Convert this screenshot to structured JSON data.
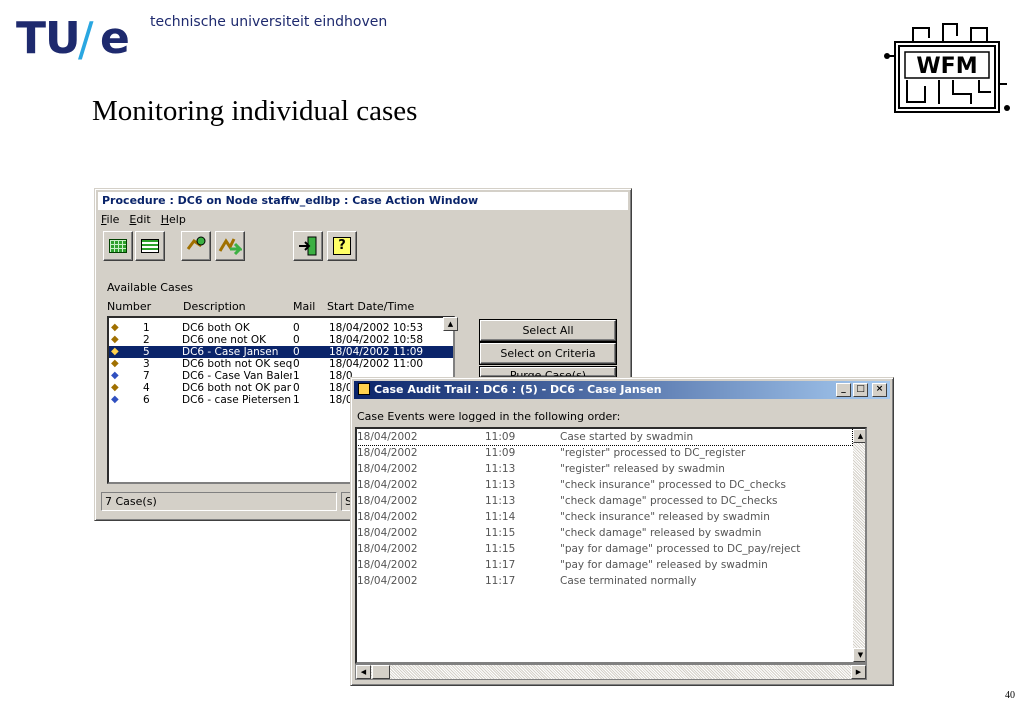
{
  "slide": {
    "logo_tu": "TU",
    "logo_slash": "/",
    "logo_e": "e",
    "university": "technische universiteit eindhoven",
    "title": "Monitoring individual cases",
    "wfm_logo_text": "WFM",
    "page_number": "40"
  },
  "main_window": {
    "title": "Procedure : DC6 on Node staffw_edlbp : Case Action Window",
    "menu": [
      {
        "label": "File",
        "accel": "F",
        "rest": "ile"
      },
      {
        "label": "Edit",
        "accel": "E",
        "rest": "dit"
      },
      {
        "label": "Help",
        "accel": "H",
        "rest": "elp"
      }
    ],
    "available_label": "Available Cases",
    "columns": {
      "number": "Number",
      "description": "Description",
      "mail": "Mail",
      "start": "Start Date/Time"
    },
    "cases": [
      {
        "number": "1",
        "description": "DC6 both OK",
        "mail": "0",
        "start": "18/04/2002 10:53",
        "selected": false
      },
      {
        "number": "2",
        "description": "DC6 one not OK",
        "mail": "0",
        "start": "18/04/2002 10:58",
        "selected": false
      },
      {
        "number": "5",
        "description": "DC6 - Case Jansen",
        "mail": "0",
        "start": "18/04/2002 11:09",
        "selected": true
      },
      {
        "number": "3",
        "description": "DC6 both not OK seq",
        "mail": "0",
        "start": "18/04/2002 11:00",
        "selected": false
      },
      {
        "number": "7",
        "description": "DC6 - Case Van Balen",
        "mail": "1",
        "start": "18/0",
        "selected": false
      },
      {
        "number": "4",
        "description": "DC6 both not OK par",
        "mail": "0",
        "start": "18/0",
        "selected": false
      },
      {
        "number": "6",
        "description": "DC6 - case Pietersen",
        "mail": "1",
        "start": "18/0",
        "selected": false
      }
    ],
    "buttons": {
      "select_all": "Select All",
      "select_criteria": "Select on Criteria",
      "purge": "Purge Case(s)"
    },
    "status": {
      "count": "7 Case(s)",
      "second": "S"
    }
  },
  "audit_window": {
    "title": "Case Audit Trail : DC6 : (5) - DC6 - Case Jansen",
    "heading": "Case Events were logged in the following order:",
    "events": [
      {
        "date": "18/04/2002",
        "time": "11:09",
        "description": "Case started by swadmin"
      },
      {
        "date": "18/04/2002",
        "time": "11:09",
        "description": "\"register\" processed to DC_register"
      },
      {
        "date": "18/04/2002",
        "time": "11:13",
        "description": "\"register\" released by swadmin"
      },
      {
        "date": "18/04/2002",
        "time": "11:13",
        "description": "\"check insurance\" processed to DC_checks"
      },
      {
        "date": "18/04/2002",
        "time": "11:13",
        "description": "\"check damage\" processed to DC_checks"
      },
      {
        "date": "18/04/2002",
        "time": "11:14",
        "description": "\"check insurance\" released by swadmin"
      },
      {
        "date": "18/04/2002",
        "time": "11:15",
        "description": "\"check damage\" released by swadmin"
      },
      {
        "date": "18/04/2002",
        "time": "11:15",
        "description": "\"pay for damage\" processed to DC_pay/reject"
      },
      {
        "date": "18/04/2002",
        "time": "11:17",
        "description": "\"pay for damage\" released by swadmin"
      },
      {
        "date": "18/04/2002",
        "time": "11:17",
        "description": "Case terminated normally"
      }
    ],
    "controls": {
      "minimize": "_",
      "maximize": "□",
      "close": "×"
    }
  },
  "icons": {
    "toolbar": [
      "grid-icon",
      "list-icon",
      "open-case-icon",
      "forward-case-icon",
      "exit-icon",
      "help-icon"
    ],
    "case_row": "case-icon"
  }
}
